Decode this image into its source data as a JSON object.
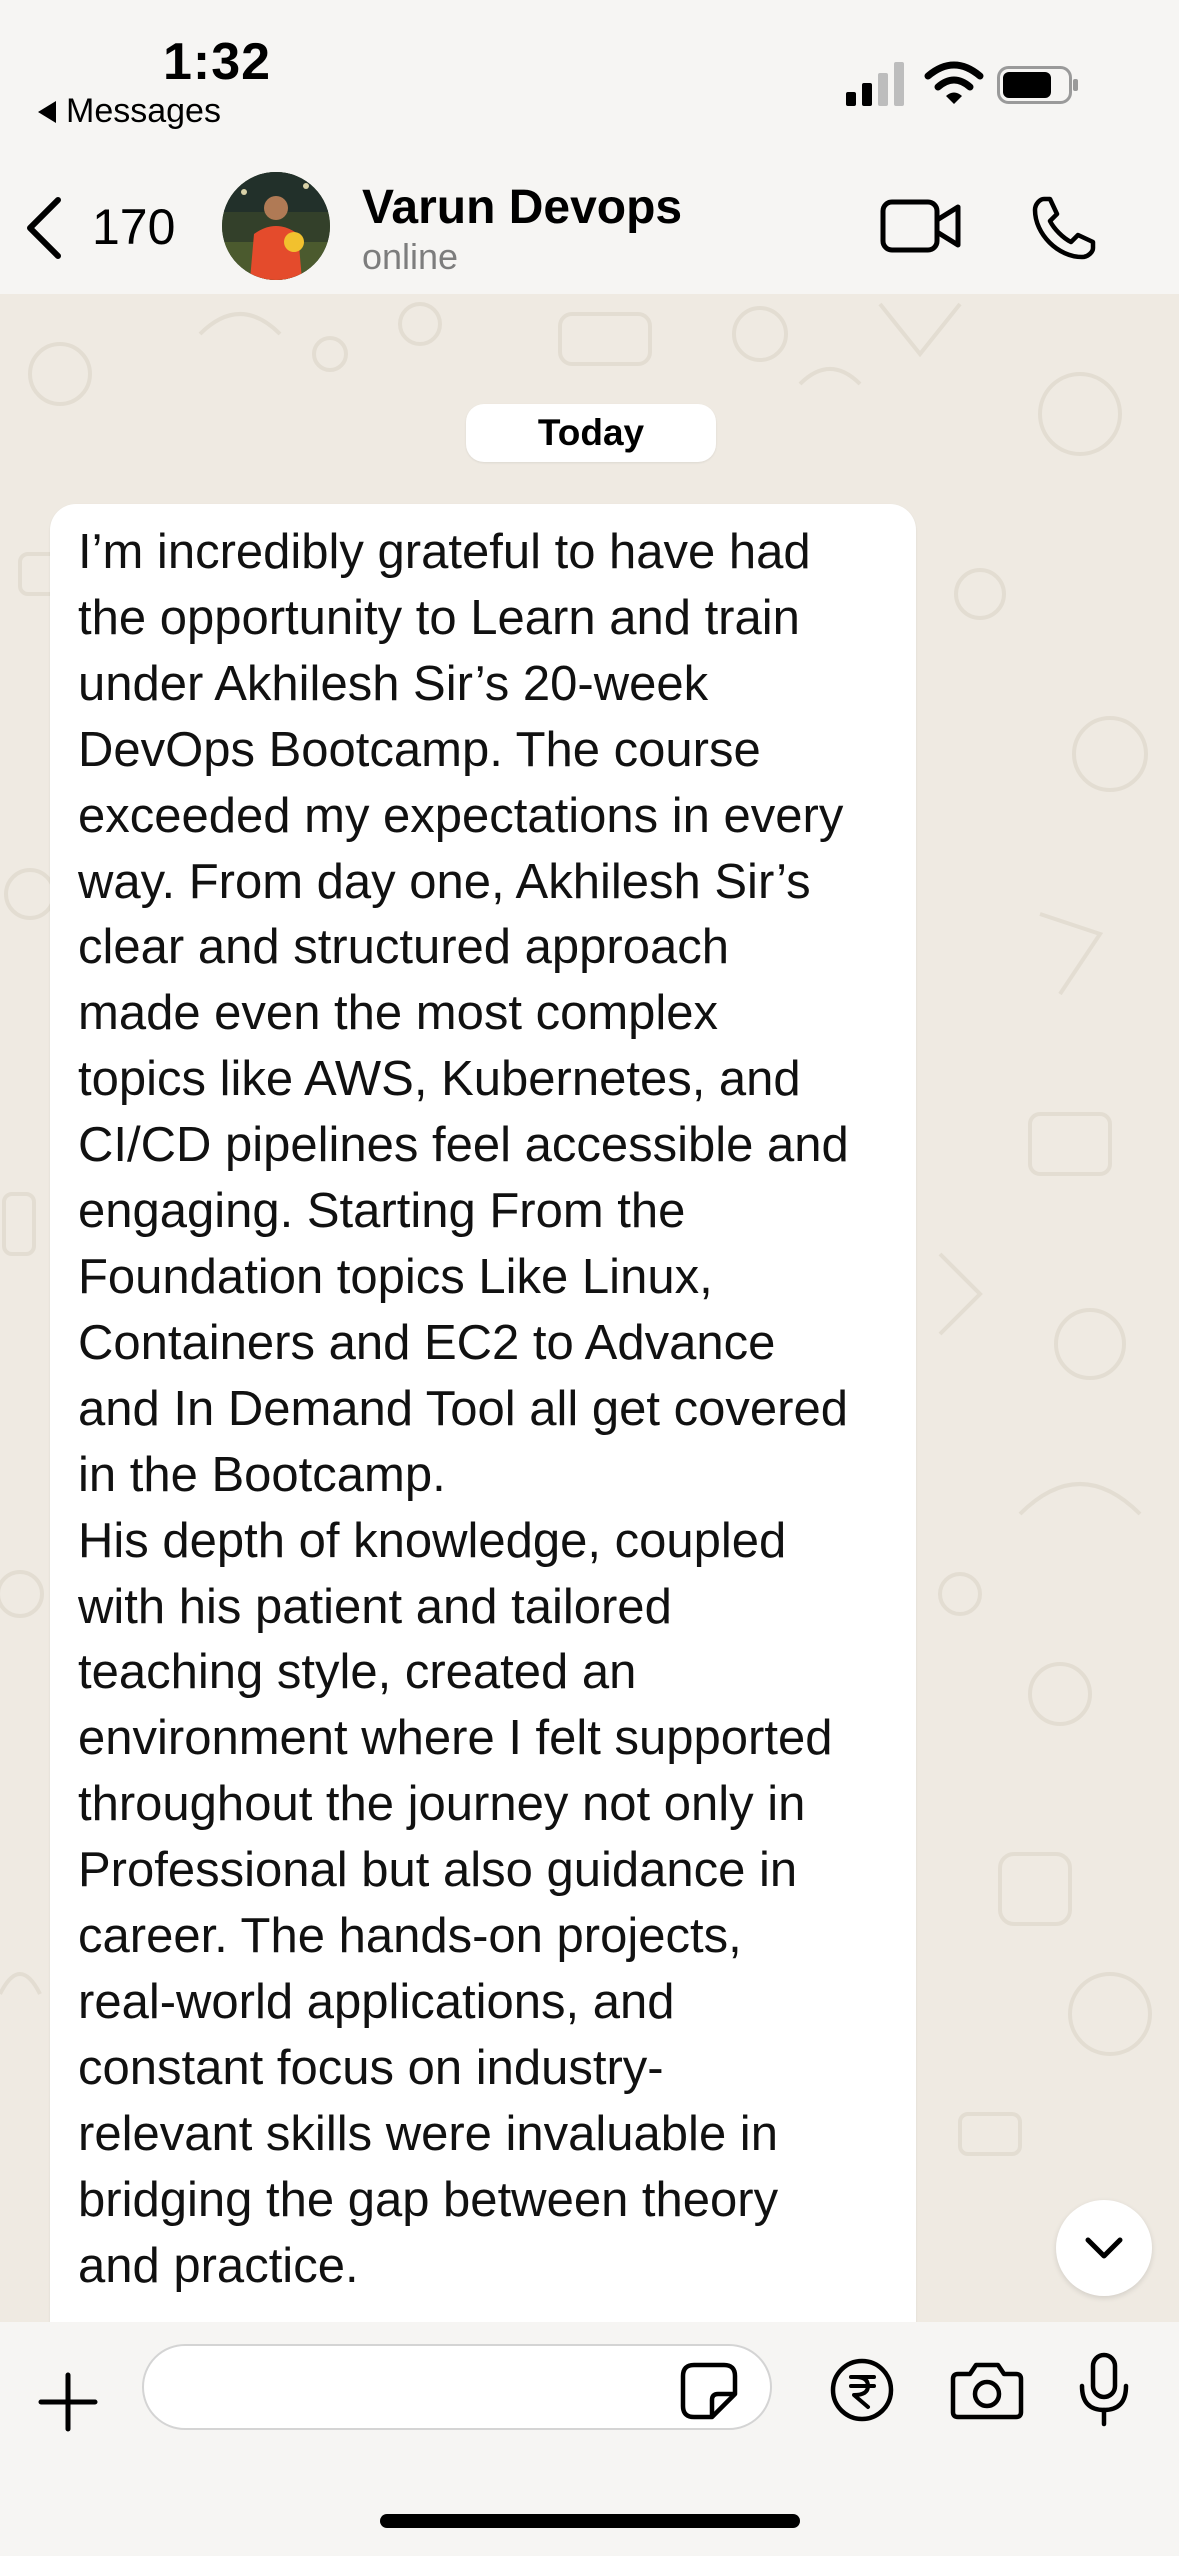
{
  "status_bar": {
    "time": "1:32",
    "back_app_label": "Messages",
    "signal_icon": "cellular-signal-icon",
    "wifi_icon": "wifi-icon",
    "battery_icon": "battery-icon"
  },
  "header": {
    "back_icon": "chevron-left-icon",
    "unread_count": "170",
    "contact_name": "Varun Devops",
    "contact_status": "online",
    "video_icon": "video-camera-icon",
    "call_icon": "phone-icon"
  },
  "chat": {
    "date_label": "Today",
    "message_text": "I’m incredibly grateful to have had\nthe opportunity to Learn and train\nunder Akhilesh Sir’s 20-week\nDevOps Bootcamp. The course\nexceeded my expectations in every\nway. From day one, Akhilesh Sir’s\nclear and structured approach\nmade even the most complex\ntopics like AWS, Kubernetes, and\nCI/CD pipelines feel accessible and\nengaging. Starting From the\nFoundation topics Like Linux,\nContainers and EC2 to Advance\nand In Demand Tool all get covered\nin the Bootcamp.\nHis depth of knowledge, coupled\nwith his patient and tailored\nteaching style, created an\nenvironment where I felt supported\nthroughout the journey not only in\nProfessional but also guidance in\ncareer. The hands-on projects,\nreal-world applications, and\nconstant focus on industry-\nrelevant skills were invaluable in\nbridging the gap between theory\nand practice.",
    "scroll_down_icon": "chevron-down-icon"
  },
  "composer": {
    "plus_icon": "plus-icon",
    "input_value": "",
    "sticker_icon": "sticker-icon",
    "payment_icon": "rupee-icon",
    "camera_icon": "camera-icon",
    "mic_icon": "microphone-icon"
  },
  "colors": {
    "background": "#f6f5f3",
    "chat_wallpaper": "#efeae2",
    "bubble": "#ffffff",
    "secondary_text": "#7d7d7d"
  }
}
